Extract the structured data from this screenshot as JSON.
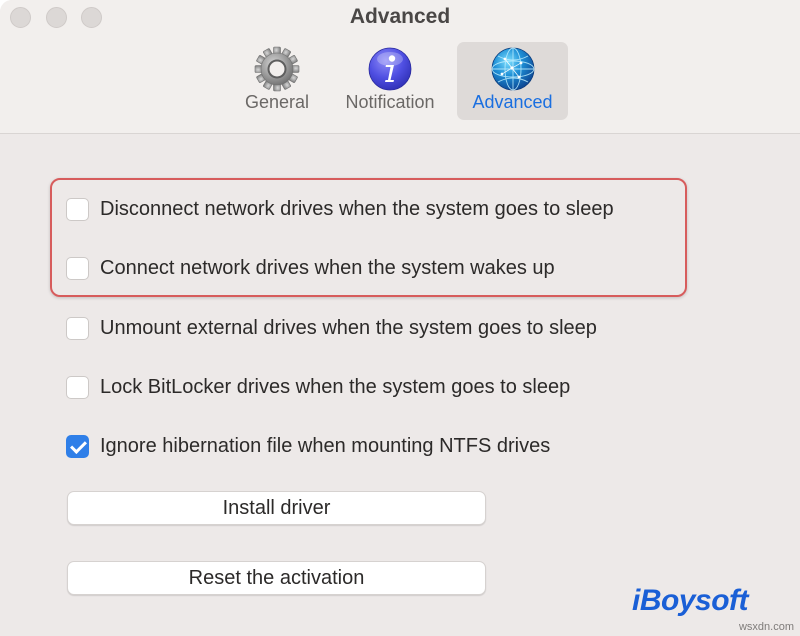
{
  "window": {
    "title": "Advanced"
  },
  "tabs": [
    {
      "label": "General",
      "icon": "gear-icon"
    },
    {
      "label": "Notification",
      "icon": "info-icon"
    },
    {
      "label": "Advanced",
      "icon": "globe-icon",
      "selected": true
    }
  ],
  "options": [
    {
      "label": "Disconnect network drives when the system goes to sleep",
      "checked": false
    },
    {
      "label": "Connect network drives when the system wakes up",
      "checked": false
    },
    {
      "label": "Unmount external drives when the system goes to sleep",
      "checked": false
    },
    {
      "label": "Lock BitLocker drives when the system goes to sleep",
      "checked": false
    },
    {
      "label": "Ignore hibernation file when mounting NTFS drives",
      "checked": true
    }
  ],
  "buttons": {
    "install": "Install driver",
    "reset": "Reset the activation"
  },
  "watermark": {
    "brand": "iBoysoft",
    "site": "wsxdn.com"
  },
  "colors": {
    "accent": "#2f7fe8",
    "selected_tab_text": "#1a6fe0",
    "highlight_border": "#d75c5c",
    "brand": "#1a5fd6"
  }
}
